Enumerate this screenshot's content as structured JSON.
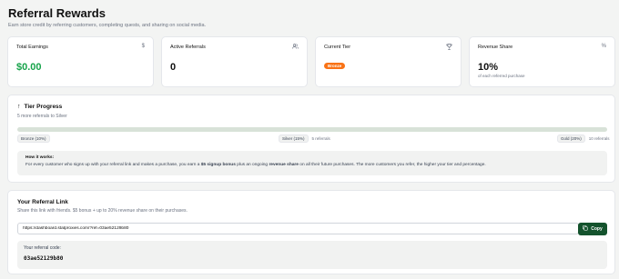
{
  "header": {
    "title": "Referral Rewards",
    "subtitle": "Earn store credit by referring customers, completing quests, and sharing on social media."
  },
  "stats": [
    {
      "label": "Total Earnings",
      "icon": "dollar-icon",
      "value": "$0.00"
    },
    {
      "label": "Active Referrals",
      "icon": "users-icon",
      "value": "0"
    },
    {
      "label": "Current Tier",
      "icon": "trophy-icon",
      "badge": "Bronze"
    },
    {
      "label": "Revenue Share",
      "icon": "percent-icon",
      "value": "10%",
      "sub": "of each referred purchase"
    }
  ],
  "tier": {
    "title": "Tier Progress",
    "subtitle": "5 more referrals to Silver",
    "progress": 0,
    "bronze": "Bronze (10%)",
    "silver": "Silver (15%)",
    "silver_req": "5 referrals",
    "gold": "Gold (20%)",
    "gold_req": "10 referrals",
    "howit_title": "How it works:",
    "howit_1": "For every customer who signs up with your referral link and makes a purchase, you earn a ",
    "howit_bold1": "$5 signup bonus",
    "howit_2": " plus an ongoing ",
    "howit_bold2": "revenue share",
    "howit_3": " on all their future purchases. The more customers you refer, the higher your tier and percentage."
  },
  "referral": {
    "title": "Your Referral Link",
    "subtitle": "Share this link with friends. $5 bonus + up to 20% revenue share on their purchases.",
    "link": "https://dashboard.statproxies.com/?ref=03ae52129b80",
    "copy_label": "Copy",
    "code_label": "Your referral code:",
    "code": "03ae52129b80"
  }
}
